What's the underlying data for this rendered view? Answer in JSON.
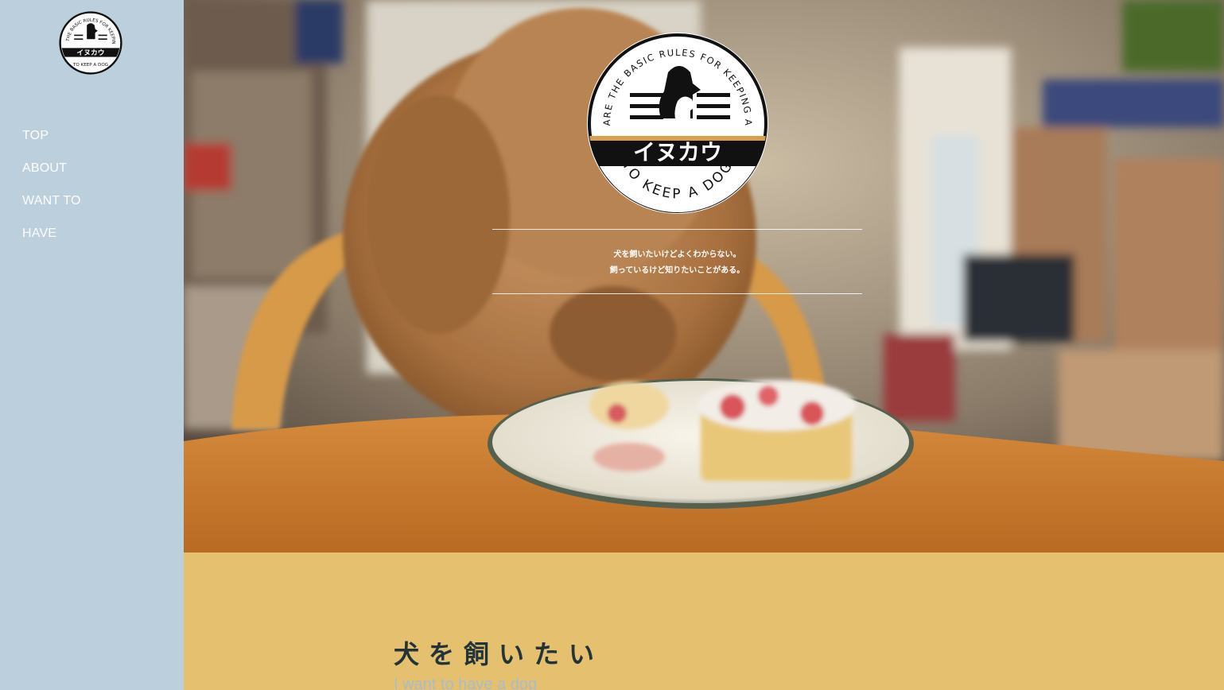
{
  "sidebar": {
    "logo_icon": "inukau-logo",
    "nav": [
      {
        "label": "TOP"
      },
      {
        "label": "ABOUT"
      },
      {
        "label": "WANT TO"
      },
      {
        "label": "HAVE"
      }
    ]
  },
  "hero": {
    "background": "poodle-eating-cake-photo",
    "logo": {
      "arc_text": "WHAT ARE THE BASIC RULES FOR KEEPING A DOG?",
      "brand": "イヌカウ",
      "bottom_text": "TO KEEP A DOG"
    },
    "tagline_line1": "犬を飼いたいけどよくわからない。",
    "tagline_line2": "飼っているけど知りたいことがある。"
  },
  "section": {
    "heading": "犬を飼いたい",
    "subheading": "I want to have a dog"
  },
  "colors": {
    "sidebar_bg": "#bccfdc",
    "section_bg": "#e4c06f",
    "heading": "#22343a",
    "subheading": "#a8bccd"
  }
}
